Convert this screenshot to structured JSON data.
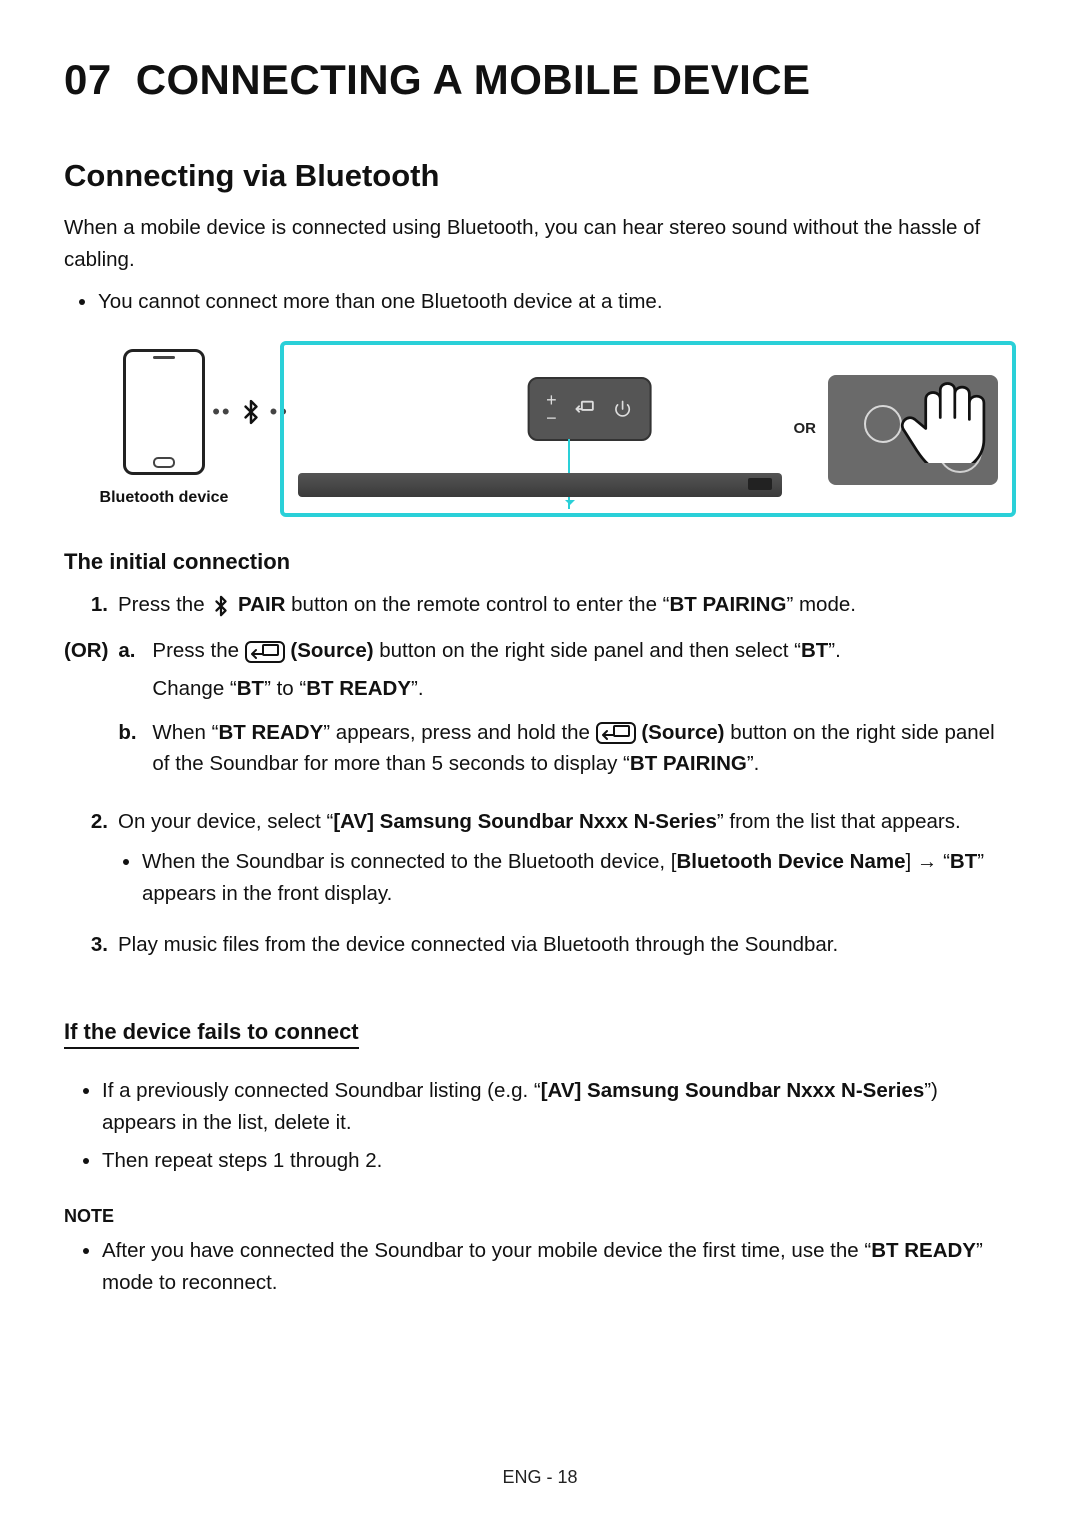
{
  "header": {
    "number": "07",
    "title": "CONNECTING A MOBILE DEVICE"
  },
  "section": {
    "subtitle": "Connecting via Bluetooth",
    "intro": "When a mobile device is connected using Bluetooth, you can hear stereo sound without the hassle of cabling.",
    "top_bullets": [
      "You cannot connect more than one Bluetooth device at a time."
    ]
  },
  "figure": {
    "bt_caption": "Bluetooth device",
    "or_label": "OR"
  },
  "initial": {
    "heading": "The initial connection",
    "step1_pre": "Press the ",
    "step1_pair": " PAIR",
    "step1_post": " button on the remote control to enter the “",
    "step1_mode": "BT PAIRING",
    "step1_tail": "” mode.",
    "or_label": "(OR)",
    "sub_a_pre": "Press the ",
    "sub_a_source": " (Source)",
    "sub_a_post": " button on the right side panel and then select “",
    "sub_a_bt": "BT",
    "sub_a_tail": "”.",
    "sub_a_line2_pre": "Change “",
    "sub_a_line2_bt": "BT",
    "sub_a_line2_mid": "” to “",
    "sub_a_line2_ready": "BT READY",
    "sub_a_line2_tail": "”.",
    "sub_b_pre": "When “",
    "sub_b_ready": "BT READY",
    "sub_b_mid": "” appears, press and hold the ",
    "sub_b_source": " (Source)",
    "sub_b_post": " button on the right side panel of the Soundbar for more than 5 seconds to display “",
    "sub_b_pairing": "BT PAIRING",
    "sub_b_tail": "”.",
    "step2_pre": "On your device, select “",
    "step2_name": "[AV] Samsung Soundbar Nxxx N-Series",
    "step2_post": "” from the list that appears.",
    "step2_bullet_pre": "When the Soundbar is connected to the Bluetooth device, [",
    "step2_bullet_name": "Bluetooth Device Name",
    "step2_bullet_mid": "] → “",
    "step2_bullet_bt": "BT",
    "step2_bullet_tail": "” appears in the front display.",
    "step3": "Play music files from the device connected via Bluetooth through the Soundbar."
  },
  "fails": {
    "heading": "If the device fails to connect",
    "b1_pre": "If a previously connected Soundbar listing (e.g. “",
    "b1_name": "[AV] Samsung Soundbar Nxxx N-Series",
    "b1_post": "”) appears in the list, delete it.",
    "b2": "Then repeat steps 1 through 2."
  },
  "note": {
    "heading": "NOTE",
    "b1_pre": "After you have connected the Soundbar to your mobile device the first time, use the “",
    "b1_ready": "BT READY",
    "b1_post": "” mode to reconnect."
  },
  "footer": "ENG - 18"
}
